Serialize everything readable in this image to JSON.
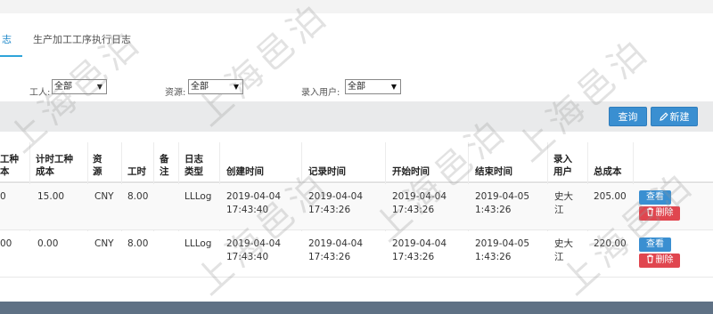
{
  "tabs": [
    {
      "label": "志",
      "active": true
    },
    {
      "label": "生产加工工序执行日志",
      "active": false
    }
  ],
  "filters": [
    {
      "label": "工人:",
      "value": "全部"
    },
    {
      "label": "资源:",
      "value": "全部"
    },
    {
      "label": "录入用户:",
      "value": "全部"
    }
  ],
  "toolbar": {
    "query_label": "查询",
    "new_label": "新建"
  },
  "table": {
    "headers": [
      [
        "工种",
        "本"
      ],
      [
        "计时工种",
        "成本"
      ],
      [
        "资",
        "源"
      ],
      [
        "工时"
      ],
      [
        "备",
        "注"
      ],
      [
        "日志",
        "类型"
      ],
      [
        "创建时间"
      ],
      [
        "记录时间"
      ],
      [
        "开始时间"
      ],
      [
        "结束时间"
      ],
      [
        "录入",
        "用户"
      ],
      [
        "总成本"
      ]
    ],
    "rows": [
      {
        "cells": [
          [
            "0"
          ],
          [
            "15.00"
          ],
          [
            "CNY"
          ],
          [
            "8.00"
          ],
          [
            ""
          ],
          [
            "LLLog"
          ],
          [
            "2019-04-04",
            "17:43:40"
          ],
          [
            "2019-04-04",
            "17:43:26"
          ],
          [
            "2019-04-04",
            "17:43:26"
          ],
          [
            "2019-04-05",
            "1:43:26"
          ],
          [
            "史大",
            "江"
          ],
          [
            "205.00"
          ]
        ]
      },
      {
        "cells": [
          [
            "00"
          ],
          [
            "0.00"
          ],
          [
            "CNY"
          ],
          [
            "8.00"
          ],
          [
            ""
          ],
          [
            "LLLog"
          ],
          [
            "2019-04-04",
            "17:43:40"
          ],
          [
            "2019-04-04",
            "17:43:26"
          ],
          [
            "2019-04-04",
            "17:43:26"
          ],
          [
            "2019-04-05",
            "1:43:26"
          ],
          [
            "史大",
            "江"
          ],
          [
            "220.00"
          ]
        ]
      }
    ],
    "row_actions": {
      "view_label": "查看",
      "delete_label": "删除"
    }
  },
  "watermark_text": "上海邑泊",
  "colors": {
    "accent": "#3a8fd1",
    "danger": "#e0464f",
    "tab_underline": "#2ea4d9",
    "footer": "#5f7185"
  }
}
